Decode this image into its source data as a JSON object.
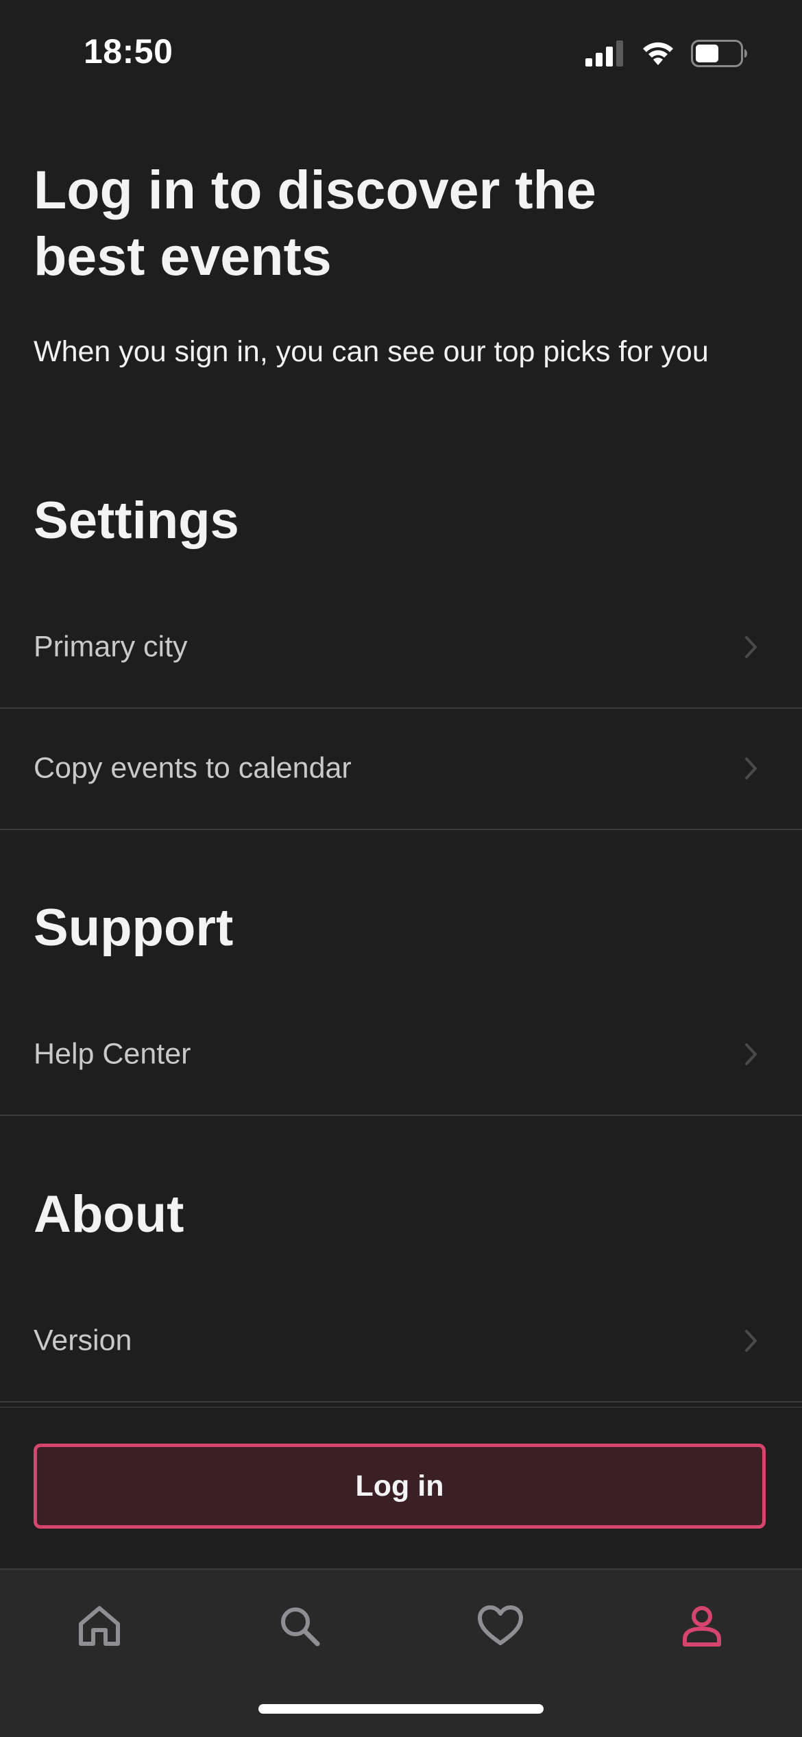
{
  "status_bar": {
    "time": "18:50",
    "icons": [
      "cellular-signal-icon",
      "wifi-icon",
      "battery-icon"
    ],
    "battery_level": 0.5
  },
  "hero": {
    "title": "Log in to discover the best events",
    "subtitle": "When you sign in, you can see our top picks for you"
  },
  "sections": {
    "settings": {
      "title": "Settings",
      "items": [
        {
          "label": "Primary city"
        },
        {
          "label": "Copy events to calendar"
        }
      ]
    },
    "support": {
      "title": "Support",
      "items": [
        {
          "label": "Help Center"
        }
      ]
    },
    "about": {
      "title": "About",
      "items": [
        {
          "label": "Version"
        }
      ]
    }
  },
  "login_button": {
    "label": "Log in"
  },
  "tab_bar": {
    "tabs": [
      {
        "icon": "home-icon",
        "active": false
      },
      {
        "icon": "search-icon",
        "active": false
      },
      {
        "icon": "heart-icon",
        "active": false
      },
      {
        "icon": "profile-icon",
        "active": true
      }
    ]
  },
  "colors": {
    "background": "#1e1e1f",
    "accent": "#d6456d",
    "button_fill": "#3a2026",
    "tab_inactive": "#8e8e93",
    "divider": "#3b3b3d"
  }
}
